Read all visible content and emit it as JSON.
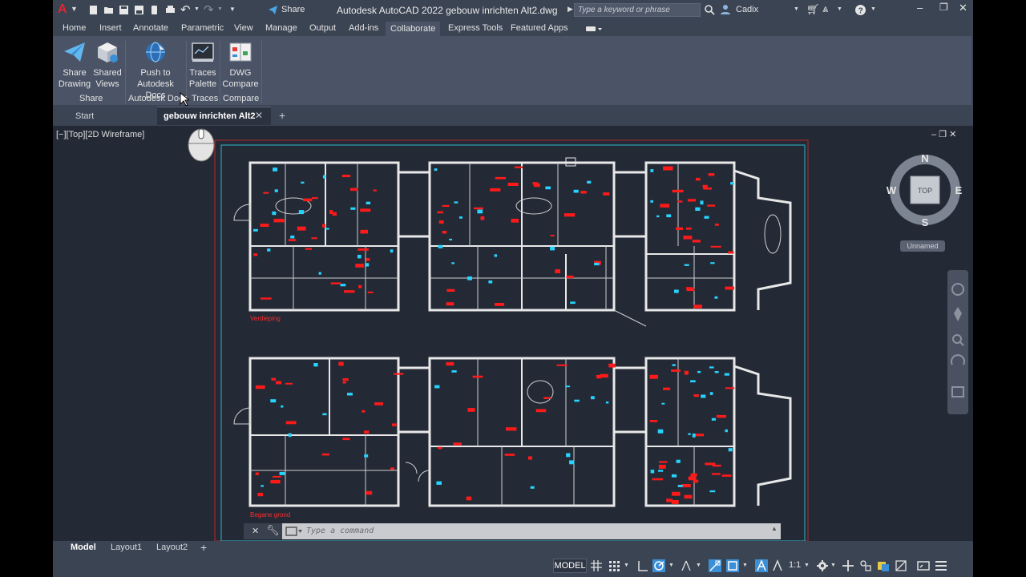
{
  "window": {
    "app_logo": "A",
    "title": "Autodesk AutoCAD 2022    gebouw inrichten Alt2.dwg",
    "share_label": "Share",
    "search_placeholder": "Type a keyword or phrase",
    "user_name": "Cadix"
  },
  "ribbon_tabs": [
    "Home",
    "Insert",
    "Annotate",
    "Parametric",
    "View",
    "Manage",
    "Output",
    "Add-ins",
    "Collaborate",
    "Express Tools",
    "Featured Apps"
  ],
  "active_tab": "Collaborate",
  "ribbon": {
    "buttons": [
      {
        "line1": "Share",
        "line2": "Drawing",
        "icon": "paper-plane-icon"
      },
      {
        "line1": "Shared",
        "line2": "Views",
        "icon": "cube-icon"
      },
      {
        "line1": "Push to",
        "line2": "Autodesk Docs",
        "icon": "globe-icon"
      },
      {
        "line1": "Traces",
        "line2": "Palette",
        "icon": "traces-icon"
      },
      {
        "line1": "DWG",
        "line2": "Compare",
        "icon": "compare-icon"
      }
    ],
    "panels": [
      "Share",
      "Autodesk Docs",
      "Traces",
      "Compare"
    ]
  },
  "file_tabs": {
    "start": "Start",
    "document": "gebouw inrichten Alt2",
    "close": "✕",
    "new": "+"
  },
  "viewport": {
    "label": "[−][Top][2D Wireframe]",
    "controls": "‒  ❐  ✕",
    "floor_label_1": "Verdieping",
    "floor_label_2": "Begane grond",
    "viewcube": {
      "north": "N",
      "south": "S",
      "east": "E",
      "west": "W",
      "face": "TOP"
    },
    "ucs_name": "Unnamed"
  },
  "command_line": {
    "placeholder": "Type a command",
    "close": "✕"
  },
  "layout_tabs": [
    "Model",
    "Layout1",
    "Layout2"
  ],
  "layout_add": "+",
  "status": {
    "model": "MODEL",
    "scale": "1:1"
  },
  "colors": {
    "background": "#3b4453",
    "viewport": "#232a36",
    "wall": "#e8e8e8",
    "furniture": "#ff1a1a",
    "fixture": "#26d4ff",
    "accent_blue": "#3a8fd6"
  }
}
